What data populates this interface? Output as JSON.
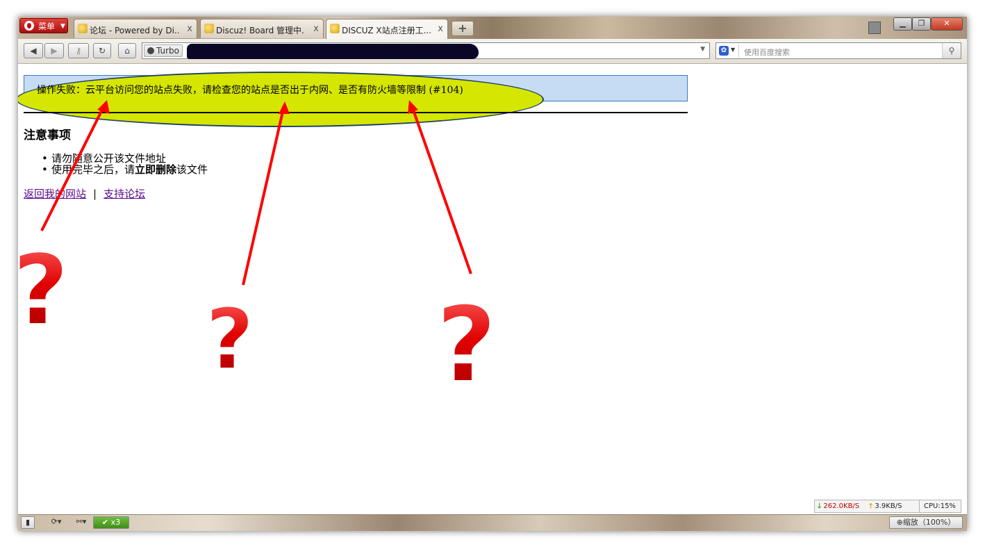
{
  "browser": {
    "menu_label": "菜单",
    "tabs": [
      {
        "title": "论坛 - Powered by Di..."
      },
      {
        "title": "Discuz! Board 管理中..."
      },
      {
        "title": "DISCUZ X站点注册工..."
      }
    ],
    "tab_close": "x",
    "new_tab": "+",
    "turbo_label": "Turbo",
    "search_placeholder": "使用百度搜索"
  },
  "page": {
    "error_message": "操作失败：云平台访问您的站点失败，请检查您的站点是否出于内网、是否有防火墙等限制 (#104)",
    "notice_title": "注意事项",
    "notices": [
      {
        "parts": [
          "请勿随意公开该文件地址"
        ]
      },
      {
        "pre": "使用完毕之后，请",
        "bold": "立即删除",
        "post": "该文件"
      }
    ],
    "links": [
      "返回我的网站",
      "支持论坛"
    ],
    "link_separator": "|"
  },
  "annotations": {
    "ellipse_color": "#d5e600",
    "arrow_color": "#ff0000",
    "question_color": "#cc0000",
    "question_mark": "?"
  },
  "statusbar": {
    "download_speed": "262.0KB/S",
    "upload_speed": "3.9KB/S",
    "cpu": "CPU:15%",
    "x3_label": "x3",
    "zoom_label": "缩放（100%）"
  }
}
